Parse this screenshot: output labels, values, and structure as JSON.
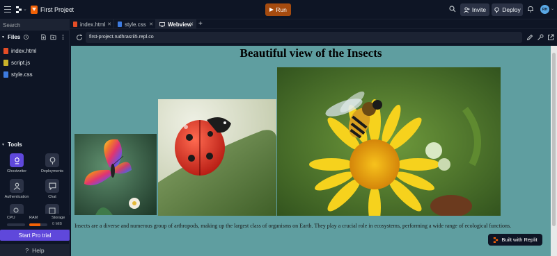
{
  "topbar": {
    "project_name": "First Project",
    "run_label": "Run",
    "invite_label": "Invite",
    "deploy_label": "Deploy",
    "avatar_initials": "RH",
    "accent": "#f26207"
  },
  "sidebar": {
    "search_placeholder": "Search",
    "files_label": "Files",
    "files": [
      {
        "name": "index.html",
        "icon": "html-file-icon",
        "color": "#e44d26"
      },
      {
        "name": "script.js",
        "icon": "js-file-icon",
        "color": "#c9b22a"
      },
      {
        "name": "style.css",
        "icon": "css-file-icon",
        "color": "#3d7be0"
      }
    ],
    "tools_label": "Tools",
    "tools": [
      {
        "label": "Ghostwriter",
        "icon": "ghostwriter-icon"
      },
      {
        "label": "Deployments",
        "icon": "deployments-icon"
      },
      {
        "label": "Authentication",
        "icon": "authentication-icon"
      },
      {
        "label": "Chat",
        "icon": "chat-icon"
      }
    ],
    "resources": {
      "cpu_label": "CPU",
      "ram_label": "RAM",
      "storage_label": "Storage",
      "storage_value": "0 MiB",
      "cpu_fraction": 0.0,
      "ram_fraction": 0.6
    },
    "pro_label": "Start Pro trial",
    "help_label": "Help"
  },
  "tabs": [
    {
      "label": "index.html",
      "icon": "html-file-icon",
      "active": false
    },
    {
      "label": "style.css",
      "icon": "css-file-icon",
      "active": false
    },
    {
      "label": "Webview",
      "icon": "monitor-icon",
      "active": true
    }
  ],
  "browser": {
    "url": "first-project.rudhrasrii5.repl.co"
  },
  "webview": {
    "title": "Beautiful view of the Insects",
    "paragraph": "Insects are a diverse and numerous group of arthropods, making up the largest class of organisms on Earth. They play a crucial role in ecosystems, performing a wide range of ecological functions.",
    "images": [
      "butterfly",
      "ladybug",
      "bee on yellow flower"
    ],
    "built_label": "Built with Replit",
    "background": "#5f9ea0"
  }
}
